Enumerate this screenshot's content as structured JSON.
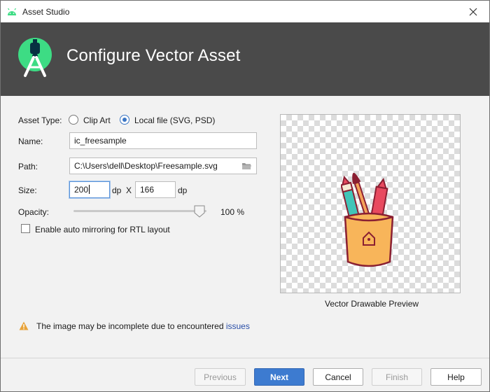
{
  "window": {
    "title": "Asset Studio",
    "header": "Configure Vector Asset"
  },
  "form": {
    "asset_type_label": "Asset Type:",
    "asset_type_options": [
      "Clip Art",
      "Local file (SVG, PSD)"
    ],
    "asset_type_selected": "Local file (SVG, PSD)",
    "name_label": "Name:",
    "name_value": "ic_freesample",
    "path_label": "Path:",
    "path_value": "C:\\Users\\dell\\Desktop\\Freesample.svg",
    "size_label": "Size:",
    "width_value": "200",
    "width_unit": "dp",
    "size_separator": "X",
    "height_value": "166",
    "height_unit": "dp",
    "opacity_label": "Opacity:",
    "opacity_value": "100 %",
    "opacity_percent": 100,
    "rtl_label": "Enable auto mirroring for RTL layout",
    "rtl_checked": false
  },
  "preview": {
    "caption": "Vector Drawable Preview"
  },
  "warning": {
    "text": "The image may be incomplete due to encountered ",
    "link_text": "issues"
  },
  "buttons": {
    "previous": "Previous",
    "next": "Next",
    "cancel": "Cancel",
    "finish": "Finish",
    "help": "Help"
  },
  "icons": {
    "app": "android-icon",
    "close": "close-icon",
    "folder": "folder-icon",
    "warning": "warning-icon"
  },
  "colors": {
    "header_bg": "#4a4a4a",
    "accent": "#3d7bd0",
    "android_green": "#3ddc84",
    "warning": "#e8a33a"
  }
}
